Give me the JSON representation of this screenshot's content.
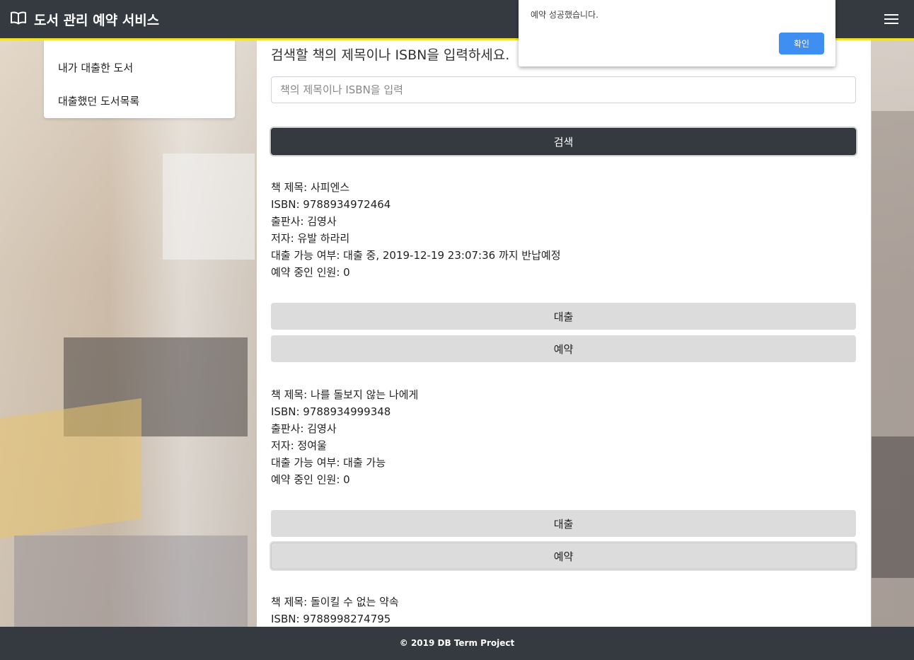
{
  "navbar": {
    "brand": "도서 관리 예약 서비스",
    "brand_icon": "book-open-icon",
    "menu_icon": "hamburger-icon"
  },
  "dropdown": {
    "items": [
      "내가 대출한 도서",
      "대출했던 도서목록"
    ]
  },
  "search": {
    "title": "검색할 책의 제목이나 ISBN을 입력하세요.",
    "placeholder": "책의 제목이나 ISBN을 입력",
    "value": "",
    "button": "검색"
  },
  "books": [
    {
      "title": "책 제목: 사피엔스",
      "isbn": "ISBN: 9788934972464",
      "publisher": "출판사: 김영사",
      "author": "저자: 유발 하라리",
      "availability": "대출 가능 여부: 대출 중, 2019-12-19 23:07:36 까지 반납예정",
      "reservations": "예약 중인 인원: 0",
      "borrow_label": "대출",
      "reserve_label": "예약"
    },
    {
      "title": "책 제목: 나를 돌보지 않는 나에게",
      "isbn": "ISBN: 9788934999348",
      "publisher": "출판사: 김영사",
      "author": "저자: 정여울",
      "availability": "대출 가능 여부: 대출 가능",
      "reservations": "예약 중인 인원: 0",
      "borrow_label": "대출",
      "reserve_label": "예약"
    },
    {
      "title": "책 제목: 돌이킬 수 없는 약속",
      "isbn": "ISBN: 9788998274795"
    }
  ],
  "footer": "© 2019 DB Term Project",
  "alert": {
    "message": "예약 성공했습니다.",
    "ok_label": "확인"
  },
  "colors": {
    "navbar": "#343a40",
    "navbar_border": "#f3e22b",
    "alert_button": "#3f8ef2",
    "gray_button": "#dcdcdc"
  }
}
